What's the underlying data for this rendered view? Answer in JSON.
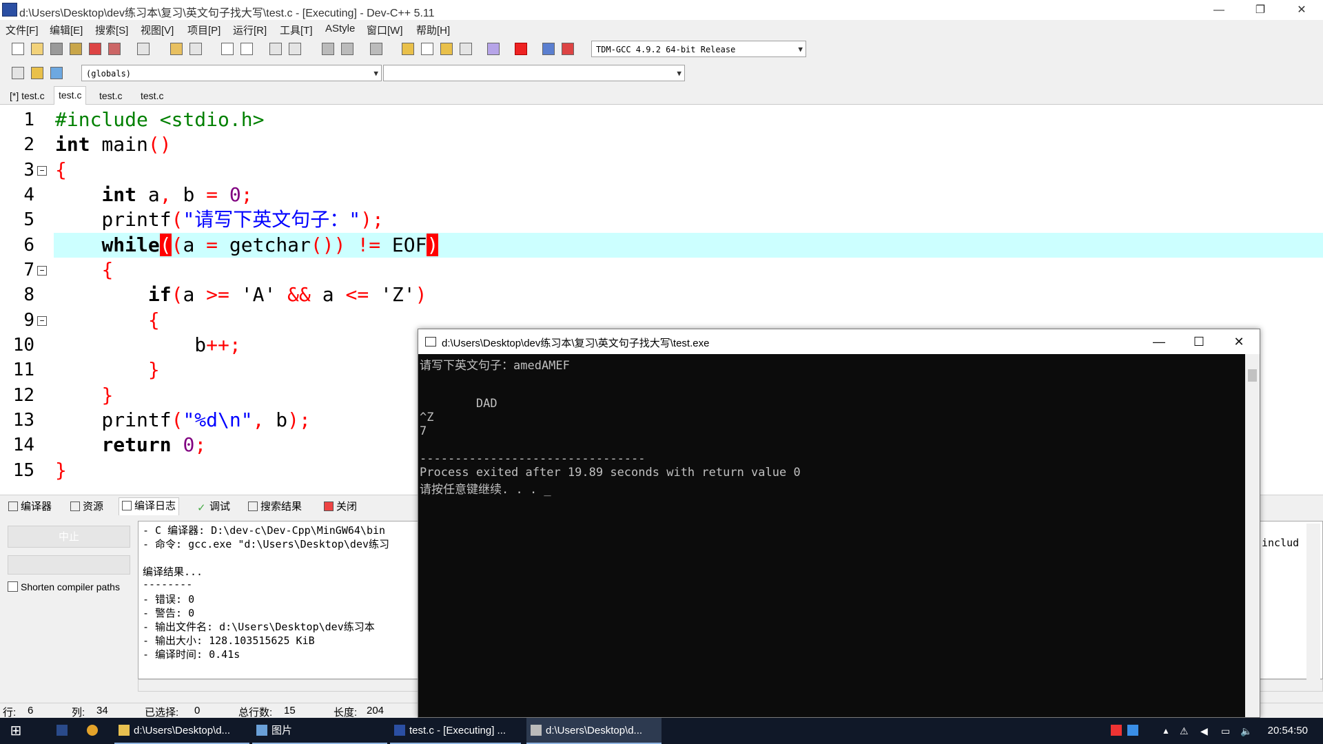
{
  "window": {
    "title": "d:\\Users\\Desktop\\dev练习本\\复习\\英文句子找大写\\test.c - [Executing] - Dev-C++ 5.11",
    "minimize": "—",
    "maximize": "❐",
    "close": "✕"
  },
  "menu": [
    "文件[F]",
    "编辑[E]",
    "搜索[S]",
    "视图[V]",
    "项目[P]",
    "运行[R]",
    "工具[T]",
    "AStyle",
    "窗口[W]",
    "帮助[H]"
  ],
  "toolbar": {
    "compiler_select": "TDM-GCC 4.9.2 64-bit Release",
    "scope_select": "(globals)",
    "function_select": ""
  },
  "tabs": [
    "[*] test.c",
    "test.c",
    "test.c",
    "test.c"
  ],
  "editor": {
    "line_numbers": [
      "1",
      "2",
      "3",
      "4",
      "5",
      "6",
      "7",
      "8",
      "9",
      "10",
      "11",
      "12",
      "13",
      "14",
      "15"
    ],
    "lines": [
      "#include <stdio.h>",
      "int main()",
      "{",
      "    int a, b = 0;",
      "    printf(\"请写下英文句子：\");",
      "    while((a = getchar()) != EOF)",
      "    {",
      "        if(a >= 'A' && a <= 'Z')",
      "        {",
      "            b++;",
      "        }",
      "    }",
      "    printf(\"%d\\n\", b);",
      "    return 0;",
      "}"
    ],
    "current_line": 6
  },
  "bottom_tabs": [
    "编译器",
    "资源",
    "编译日志",
    "调试",
    "搜索结果",
    "关闭"
  ],
  "compile_panel": {
    "stop_button": "中止",
    "shorten_label": "Shorten compiler paths",
    "log_lines": [
      "- C 编译器: D:\\dev-c\\Dev-Cpp\\MinGW64\\bin",
      "- 命令: gcc.exe \"d:\\Users\\Desktop\\dev练习",
      "",
      "编译结果...",
      "--------",
      "- 错误: 0",
      "- 警告: 0",
      "- 输出文件名: d:\\Users\\Desktop\\dev练习本",
      "- 输出大小: 128.103515625 KiB",
      "- 编译时间: 0.41s"
    ],
    "log_right_fragment": "includ"
  },
  "statusbar": {
    "row_label": "行:",
    "row_value": "6",
    "col_label": "列:",
    "col_value": "34",
    "sel_label": "已选择:",
    "sel_value": "0",
    "total_label": "总行数:",
    "total_value": "15",
    "len_label": "长度:",
    "len_value": "204"
  },
  "console": {
    "title": "d:\\Users\\Desktop\\dev练习本\\复习\\英文句子找大写\\test.exe",
    "lines": [
      "请写下英文句子：amedAMEF",
      "",
      "",
      "        DAD",
      "^Z",
      "7",
      "",
      "--------------------------------",
      "Process exited after 19.89 seconds with return value 0",
      "请按任意键继续. . . _"
    ]
  },
  "taskbar": {
    "explorer_label": "d:\\Users\\Desktop\\d...",
    "pictures_label": "图片",
    "devcpp_label": "test.c - [Executing] ...",
    "console_label": "d:\\Users\\Desktop\\d...",
    "clock": "20:54:50"
  },
  "colors": {
    "current_line": "#ccffff",
    "keyword": "#000000",
    "preprocessor": "#008000",
    "string": "#0000ff",
    "number": "#800080",
    "symbol": "#ff0000",
    "console_bg": "#0c0c0c",
    "console_fg": "#c0c0c0",
    "taskbar_bg": "#101828"
  }
}
